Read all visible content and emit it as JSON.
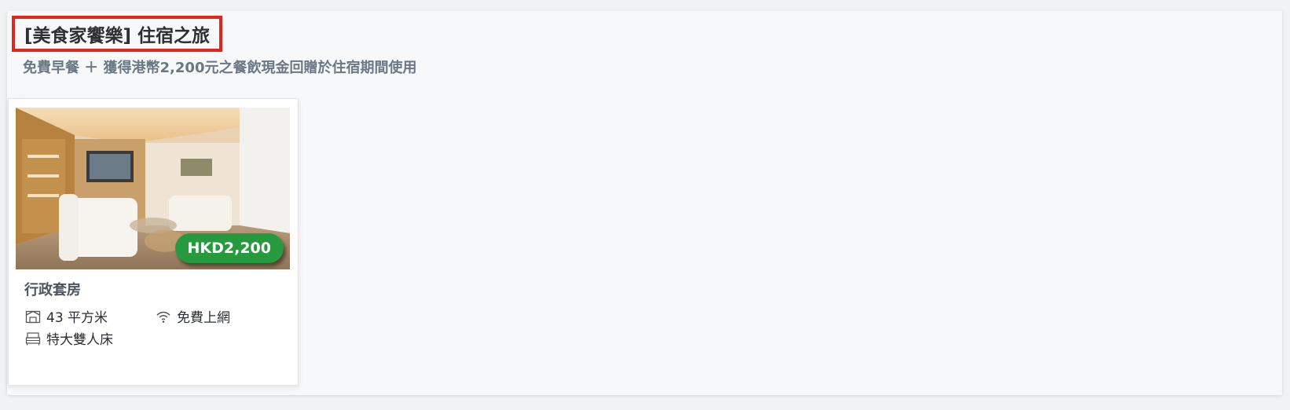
{
  "package": {
    "title": "[美食家饗樂] 住宿之旅",
    "subtitle": "免費早餐 ＋ 獲得港幣2,200元之餐飲現金回贈於住宿期間使用"
  },
  "room": {
    "name": "行政套房",
    "price": "HKD2,200",
    "size": "43 平方米",
    "wifi": "免費上網",
    "bed": "特大雙人床",
    "image_alt": "行政套房"
  },
  "icons": {
    "size": "room-size-icon",
    "wifi": "wifi-icon",
    "bed": "bed-icon"
  },
  "colors": {
    "title_border": "#e0261c",
    "price_badge": "#279a3f",
    "subtitle_text": "#6b7785"
  }
}
